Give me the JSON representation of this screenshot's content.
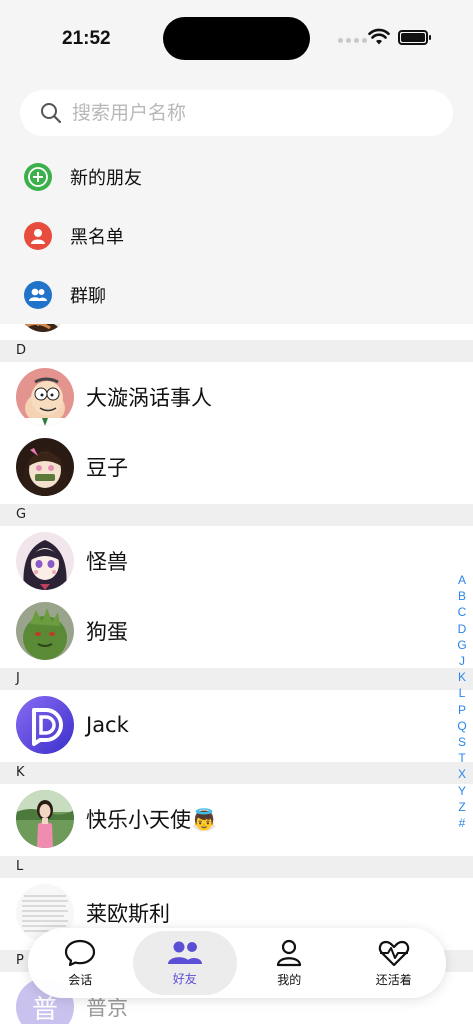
{
  "status": {
    "time": "21:52"
  },
  "search": {
    "placeholder": "搜索用户名称"
  },
  "menu": [
    {
      "label": "新的朋友",
      "icon": "add-circle-icon",
      "color": "#3cb04a"
    },
    {
      "label": "黑名单",
      "icon": "user-block-icon",
      "color": "#e84c3d"
    },
    {
      "label": "群聊",
      "icon": "group-icon",
      "color": "#1f73c8"
    }
  ],
  "sections": [
    "D",
    "G",
    "J",
    "K",
    "L",
    "P"
  ],
  "contacts": [
    {
      "name": "大漩涡话事人",
      "section": "D"
    },
    {
      "name": "豆子",
      "section": "D"
    },
    {
      "name": "怪兽",
      "section": "G"
    },
    {
      "name": "狗蛋",
      "section": "G"
    },
    {
      "name": "Jack",
      "section": "J"
    },
    {
      "name": "快乐小天使👼",
      "section": "K"
    },
    {
      "name": "莱欧斯利",
      "section": "L"
    },
    {
      "name": "普京",
      "section": "P",
      "avatar_text": "普"
    }
  ],
  "index": [
    "A",
    "B",
    "C",
    "D",
    "G",
    "J",
    "K",
    "L",
    "P",
    "Q",
    "S",
    "T",
    "X",
    "Y",
    "Z",
    "#"
  ],
  "tabs": [
    {
      "label": "会话",
      "icon": "chat-bubble-icon"
    },
    {
      "label": "好友",
      "icon": "friends-icon",
      "active": true
    },
    {
      "label": "我的",
      "icon": "person-icon"
    },
    {
      "label": "还活着",
      "icon": "heartbeat-icon"
    }
  ],
  "colors": {
    "accent": "#5b4fd6",
    "index": "#2a86e8"
  }
}
